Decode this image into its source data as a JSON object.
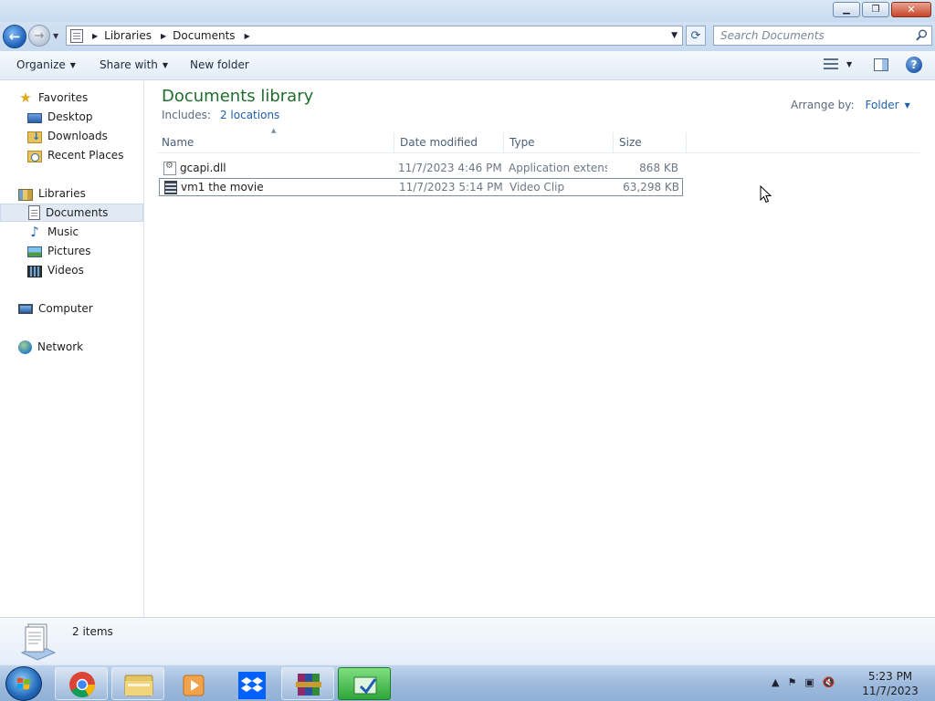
{
  "window": {
    "minimize_glyph": "▁",
    "restore_glyph": "❐",
    "close_glyph": "✕"
  },
  "address": {
    "crumbs": [
      "Libraries",
      "Documents"
    ],
    "search_placeholder": "Search Documents"
  },
  "toolbar": {
    "organize": "Organize",
    "share_with": "Share with",
    "new_folder": "New folder"
  },
  "nav": {
    "favorites": "Favorites",
    "desktop": "Desktop",
    "downloads": "Downloads",
    "recent_places": "Recent Places",
    "libraries": "Libraries",
    "documents": "Documents",
    "music": "Music",
    "pictures": "Pictures",
    "videos": "Videos",
    "computer": "Computer",
    "network": "Network"
  },
  "library": {
    "title": "Documents library",
    "includes_label": "Includes:",
    "includes_link": "2 locations",
    "arrange_label": "Arrange by:",
    "arrange_value": "Folder"
  },
  "columns": {
    "name": "Name",
    "date_modified": "Date modified",
    "type": "Type",
    "size": "Size"
  },
  "files": [
    {
      "name": "gcapi.dll",
      "date": "11/7/2023 4:46 PM",
      "type": "Application extens...",
      "size": "868 KB",
      "icon": "dll-file-icon"
    },
    {
      "name": "vm1 the movie",
      "date": "11/7/2023 5:14 PM",
      "type": "Video Clip",
      "size": "63,298 KB",
      "icon": "video-file-icon"
    }
  ],
  "details": {
    "count": "2 items"
  },
  "taskbar": {
    "apps": [
      "chrome-icon",
      "file-explorer-icon",
      "media-player-icon",
      "dropbox-icon",
      "winrar-icon",
      "green-app-icon"
    ],
    "time": "5:23 PM",
    "date": "11/7/2023"
  },
  "colors": {
    "library_title": "#1e6e2c",
    "link": "#1f5fae",
    "taskbar": "#9fbbdd"
  }
}
